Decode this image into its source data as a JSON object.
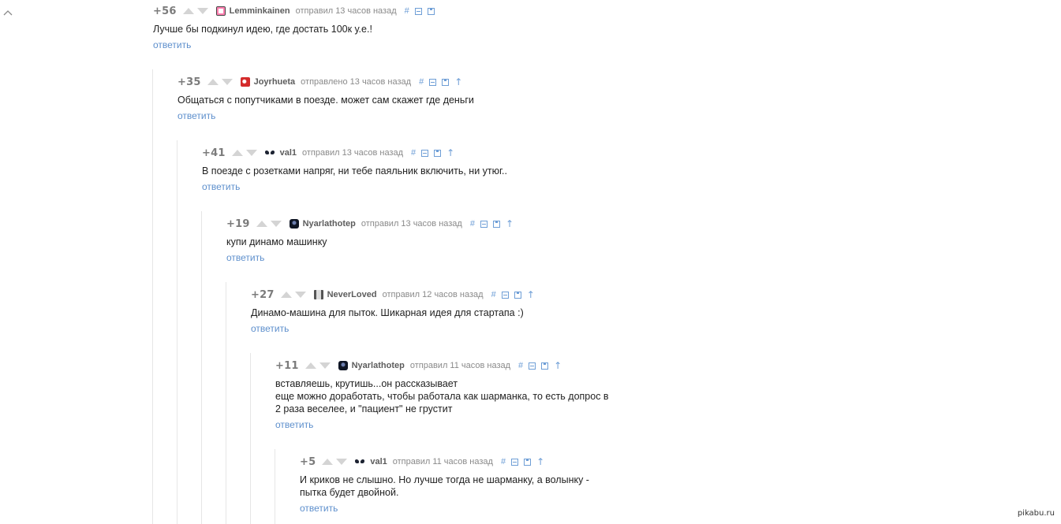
{
  "comments": [
    {
      "rating": "+56",
      "author": "Lemminkainen",
      "time": "отправил 13 часов назад",
      "text_lines": [
        "Лучше бы подкинул идею, где достать 100к у.е.!"
      ],
      "reply": "ответить",
      "has_parent_link": false
    },
    {
      "rating": "+35",
      "author": "Joyrhueta",
      "time": "отправлено 13 часов назад",
      "text_lines": [
        "Общаться с попутчиками в поезде. может сам скажет где деньги"
      ],
      "reply": "ответить",
      "has_parent_link": true
    },
    {
      "rating": "+41",
      "author": "val1",
      "time": "отправил 13 часов назад",
      "text_lines": [
        "В поезде с розетками напряг, ни тебе паяльник включить, ни утюг.."
      ],
      "reply": "ответить",
      "has_parent_link": true
    },
    {
      "rating": "+19",
      "author": "Nyarlathotep",
      "time": "отправил 13 часов назад",
      "text_lines": [
        "купи динамо машинку"
      ],
      "reply": "ответить",
      "has_parent_link": true
    },
    {
      "rating": "+27",
      "author": "NeverLoved",
      "time": "отправил 12 часов назад",
      "text_lines": [
        "Динамо-машина для пыток. Шикарная идея для стартапа :)"
      ],
      "reply": "ответить",
      "has_parent_link": true
    },
    {
      "rating": "+11",
      "author": "Nyarlathotep",
      "time": "отправил 11 часов назад",
      "text_lines": [
        "вставляешь, крутишь...он рассказывает",
        "еще можно доработать, чтобы работала как шарманка, то есть допрос в",
        "2 раза веселее, и \"пациент\" не грустит"
      ],
      "reply": "ответить",
      "has_parent_link": true
    },
    {
      "rating": "+5",
      "author": "val1",
      "time": "отправил 11 часов назад",
      "text_lines": [
        "И криков не слышно. Но лучше тогда не шарманку, а волынку -",
        "пытка будет двойной."
      ],
      "reply": "ответить",
      "has_parent_link": true
    }
  ],
  "toolbar_icons": {
    "link": "#",
    "collapse": "minus-box-icon",
    "save": "save-icon",
    "parent": "↑"
  },
  "avatars": [
    "avatar-pink",
    "avatar-red",
    "avatar-eyes",
    "avatar-dark",
    "avatar-gray",
    "avatar-dark",
    "avatar-eyes"
  ],
  "watermark": "pikabu.ru",
  "colors": {
    "link": "#5d8fcc",
    "rating": "#7b7b7b",
    "author": "#5c5c5c",
    "thread_line": "#e6e6e6"
  }
}
